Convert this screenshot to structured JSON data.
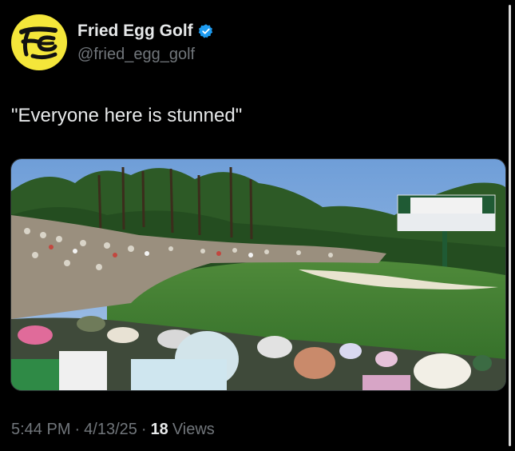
{
  "author": {
    "display_name": "Fried Egg Golf",
    "handle": "@fried_egg_golf",
    "verified": true,
    "avatar_bg": "#f4e63a",
    "avatar_icon": "fried-egg-logo-icon",
    "verified_color": "#1d9bf0"
  },
  "tweet": {
    "text": "\"Everyone here is stunned\"",
    "media": {
      "icon": "golf-course-crowd-photo"
    }
  },
  "meta": {
    "time": "5:44 PM",
    "sep1": "·",
    "date": "4/13/25",
    "sep2": "·",
    "views_count": "18",
    "views_label": "Views"
  }
}
